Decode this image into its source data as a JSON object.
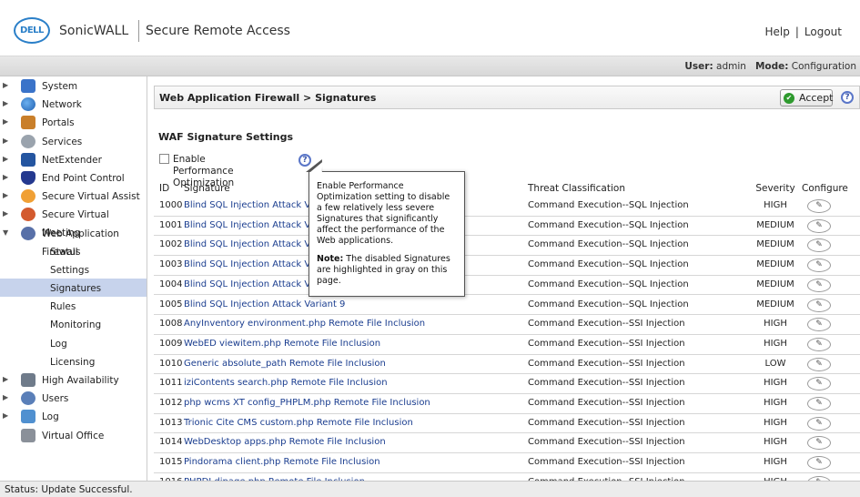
{
  "header": {
    "logo_text": "DELL",
    "brand": "SonicWALL",
    "product": "Secure Remote Access",
    "links": {
      "help": "Help",
      "separator": "|",
      "logout": "Logout"
    }
  },
  "userbar": {
    "user_label": "User:",
    "user_value": "admin",
    "mode_label": "Mode:",
    "mode_value": "Configuration"
  },
  "sidebar": {
    "items": [
      {
        "label": "System",
        "icon": "monitor-icon"
      },
      {
        "label": "Network",
        "icon": "globe-icon"
      },
      {
        "label": "Portals",
        "icon": "house-icon"
      },
      {
        "label": "Services",
        "icon": "gears-icon"
      },
      {
        "label": "NetExtender",
        "icon": "network-tower-icon"
      },
      {
        "label": "End Point Control",
        "icon": "shield-icon"
      },
      {
        "label": "Secure Virtual Assist",
        "icon": "assist-person-icon"
      },
      {
        "label": "Secure Virtual Meeting",
        "icon": "meeting-people-icon"
      },
      {
        "label": "Web Application Firewall",
        "icon": "firewall-globe-icon"
      },
      {
        "label": "Status"
      },
      {
        "label": "Settings"
      },
      {
        "label": "Signatures"
      },
      {
        "label": "Rules"
      },
      {
        "label": "Monitoring"
      },
      {
        "label": "Log"
      },
      {
        "label": "Licensing"
      },
      {
        "label": "High Availability",
        "icon": "servers-icon"
      },
      {
        "label": "Users",
        "icon": "users-icon"
      },
      {
        "label": "Log",
        "icon": "log-document-icon"
      },
      {
        "label": "Virtual Office",
        "icon": "building-icon"
      }
    ],
    "active_item": "Signatures"
  },
  "main": {
    "breadcrumb": "Web Application Firewall > Signatures",
    "accept_label": "Accept",
    "section_title": "WAF Signature Settings",
    "perf_checkbox_label": "Enable Performance Optimization",
    "perf_checkbox_checked": false,
    "columns": {
      "id": "ID",
      "signature": "Signature",
      "threat": "Threat Classification",
      "severity": "Severity",
      "configure": "Configure"
    },
    "rows": [
      {
        "id": "1000",
        "signature": "Blind SQL Injection Attack Variant",
        "threat": "Command Execution--SQL Injection",
        "severity": "HIGH"
      },
      {
        "id": "1001",
        "signature": "Blind SQL Injection Attack Variant",
        "threat": "Command Execution--SQL Injection",
        "severity": "MEDIUM"
      },
      {
        "id": "1002",
        "signature": "Blind SQL Injection Attack Variant",
        "threat": "Command Execution--SQL Injection",
        "severity": "MEDIUM"
      },
      {
        "id": "1003",
        "signature": "Blind SQL Injection Attack Variant",
        "threat": "Command Execution--SQL Injection",
        "severity": "MEDIUM"
      },
      {
        "id": "1004",
        "signature": "Blind SQL Injection Attack Variant",
        "threat": "Command Execution--SQL Injection",
        "severity": "MEDIUM"
      },
      {
        "id": "1005",
        "signature": "Blind SQL Injection Attack Variant 9",
        "threat": "Command Execution--SQL Injection",
        "severity": "MEDIUM"
      },
      {
        "id": "1008",
        "signature": "AnyInventory environment.php Remote File Inclusion",
        "threat": "Command Execution--SSI Injection",
        "severity": "HIGH"
      },
      {
        "id": "1009",
        "signature": "WebED viewitem.php Remote File Inclusion",
        "threat": "Command Execution--SSI Injection",
        "severity": "HIGH"
      },
      {
        "id": "1010",
        "signature": "Generic absolute_path Remote File Inclusion",
        "threat": "Command Execution--SSI Injection",
        "severity": "LOW"
      },
      {
        "id": "1011",
        "signature": "iziContents search.php Remote File Inclusion",
        "threat": "Command Execution--SSI Injection",
        "severity": "HIGH"
      },
      {
        "id": "1012",
        "signature": "php wcms XT config_PHPLM.php Remote File Inclusion",
        "threat": "Command Execution--SSI Injection",
        "severity": "HIGH"
      },
      {
        "id": "1013",
        "signature": "Trionic Cite CMS custom.php Remote File Inclusion",
        "threat": "Command Execution--SSI Injection",
        "severity": "HIGH"
      },
      {
        "id": "1014",
        "signature": "WebDesktop apps.php Remote File Inclusion",
        "threat": "Command Execution--SSI Injection",
        "severity": "HIGH"
      },
      {
        "id": "1015",
        "signature": "Pindorama client.php Remote File Inclusion",
        "threat": "Command Execution--SSI Injection",
        "severity": "HIGH"
      },
      {
        "id": "1016",
        "signature": "PHPDJ dipage.php Remote File Inclusion",
        "threat": "Command Execution--SSI Injection",
        "severity": "HIGH"
      }
    ],
    "tooltip": {
      "text": "Enable Performance Optimization setting to disable a few relatively less severe Signatures that significantly affect the performance of the Web applications.",
      "note_label": "Note:",
      "note_text": "The disabled Signatures are highlighted in gray on this page."
    }
  },
  "status": "Status: Update Successful.",
  "colors": {
    "link": "#1a3d8f",
    "active_nav": "#c7d3ec",
    "accept_check": "#2e9a2e",
    "logo_blue": "#2a7fc8"
  }
}
